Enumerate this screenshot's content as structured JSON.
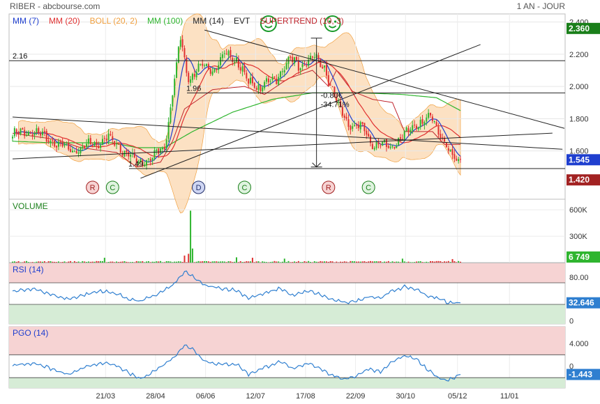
{
  "header": {
    "title": "RIBER - abcbourse.com",
    "period": "1 AN - JOUR"
  },
  "legend": [
    {
      "label": "MM (7)",
      "color": "#1f3fcf"
    },
    {
      "label": "MM (20)",
      "color": "#e03131"
    },
    {
      "label": "BOLL (20, 2)",
      "color": "#f0a040"
    },
    {
      "label": "MM (100)",
      "color": "#2fb52f"
    },
    {
      "label": "MM (14)",
      "color": "#222222"
    },
    {
      "label": "EVT",
      "color": "#222222"
    },
    {
      "label": "SUPERTREND (10, 3)",
      "color": "#c0262e"
    }
  ],
  "colors": {
    "up": "#2fb52f",
    "down": "#e03131",
    "ma7": "#1f3fcf",
    "ma20": "#e03131",
    "ma100": "#2fb52f",
    "boll_fill": "#fbdcb8",
    "boll_edge": "#f0a040",
    "rsi_line": "#2f7fd0",
    "overbought": "#f6d3d3",
    "oversold": "#d6ecd6",
    "tag_up": "#1a7f1a",
    "tag_mid": "#23306b",
    "tag_down": "#a22222"
  },
  "chart_data": [
    {
      "type": "candlestick",
      "panel": "price",
      "x_ticks": [
        "21/03",
        "28/04",
        "06/06",
        "12/07",
        "17/08",
        "22/09",
        "30/10",
        "05/12",
        "11/01"
      ],
      "ylim": [
        1.3,
        2.45
      ],
      "y_ticks": [
        1.6,
        1.8,
        2.0,
        2.2,
        2.4
      ],
      "y_tick_labels": [
        "1.600",
        "1.800",
        "2.000",
        "2.200",
        "2.400"
      ],
      "badges": [
        {
          "value": 2.36,
          "label": "2.360",
          "color": "#1a7f1a"
        },
        {
          "value": 1.545,
          "label": "1.545",
          "color": "#1f3fcf"
        },
        {
          "value": 1.42,
          "label": "1.420",
          "color": "#a22222"
        }
      ],
      "anchors": [
        [
          0,
          1.7
        ],
        [
          10,
          1.72
        ],
        [
          20,
          1.66
        ],
        [
          28,
          1.6
        ],
        [
          38,
          1.63
        ],
        [
          48,
          1.68
        ],
        [
          56,
          1.6
        ],
        [
          62,
          1.53
        ],
        [
          70,
          1.55
        ],
        [
          76,
          1.63
        ],
        [
          80,
          1.95
        ],
        [
          84,
          2.3
        ],
        [
          88,
          2.05
        ],
        [
          94,
          2.12
        ],
        [
          100,
          2.1
        ],
        [
          106,
          2.2
        ],
        [
          112,
          2.17
        ],
        [
          118,
          2.02
        ],
        [
          124,
          2.0
        ],
        [
          132,
          2.05
        ],
        [
          138,
          2.17
        ],
        [
          144,
          2.12
        ],
        [
          150,
          2.18
        ],
        [
          156,
          2.12
        ],
        [
          162,
          1.9
        ],
        [
          168,
          1.76
        ],
        [
          174,
          1.75
        ],
        [
          180,
          1.65
        ],
        [
          188,
          1.62
        ],
        [
          196,
          1.7
        ],
        [
          204,
          1.78
        ],
        [
          210,
          1.8
        ],
        [
          214,
          1.72
        ],
        [
          218,
          1.6
        ],
        [
          222,
          1.53
        ],
        [
          224,
          1.545
        ]
      ],
      "supertrend": [
        [
          0,
          1.71
        ],
        [
          22,
          1.67
        ],
        [
          34,
          1.62
        ],
        [
          52,
          1.59
        ],
        [
          62,
          1.5
        ],
        [
          74,
          1.53
        ],
        [
          80,
          1.66
        ],
        [
          86,
          1.86
        ],
        [
          100,
          1.98
        ],
        [
          116,
          2.0
        ],
        [
          126,
          1.95
        ],
        [
          138,
          2.05
        ],
        [
          150,
          2.1
        ],
        [
          158,
          2.0
        ],
        [
          162,
          2.1
        ],
        [
          170,
          1.97
        ],
        [
          180,
          1.92
        ],
        [
          190,
          1.9
        ],
        [
          196,
          1.72
        ],
        [
          210,
          1.72
        ],
        [
          216,
          1.64
        ],
        [
          224,
          1.64
        ]
      ],
      "ma100": [
        [
          0,
          1.66
        ],
        [
          20,
          1.65
        ],
        [
          50,
          1.65
        ],
        [
          62,
          1.62
        ],
        [
          76,
          1.62
        ],
        [
          90,
          1.72
        ],
        [
          110,
          1.84
        ],
        [
          130,
          1.92
        ],
        [
          150,
          1.96
        ],
        [
          175,
          1.96
        ],
        [
          195,
          1.95
        ],
        [
          212,
          1.93
        ],
        [
          224,
          1.85
        ]
      ],
      "horizontal_lines": [
        {
          "value": 2.16,
          "label": "2.16"
        },
        {
          "value": 1.96,
          "label": "1.96"
        },
        {
          "value": 1.49,
          "label": "1.49"
        }
      ],
      "trend_lines": [
        {
          "from": [
            0,
            1.81
          ],
          "to": [
            275,
            1.61
          ]
        },
        {
          "from": [
            0,
            1.55
          ],
          "to": [
            270,
            1.71
          ]
        },
        {
          "from": [
            96,
            2.35
          ],
          "to": [
            276,
            1.74
          ]
        },
        {
          "from": [
            64,
            1.43
          ],
          "to": [
            234,
            2.26
          ]
        }
      ],
      "measure": {
        "from": 2.3,
        "to": 1.5,
        "labels": [
          "-0.80€",
          "-34.71%"
        ]
      },
      "markers": [
        {
          "label": "R",
          "kind": "down"
        },
        {
          "label": "C",
          "kind": "up"
        },
        {
          "label": "D",
          "kind": "mid"
        },
        {
          "label": "C",
          "kind": "up"
        },
        {
          "label": "R",
          "kind": "down"
        },
        {
          "label": "C",
          "kind": "up"
        }
      ],
      "markers_x": [
        40,
        50,
        93,
        116,
        158,
        178
      ],
      "smileys_x": [
        128,
        160
      ]
    },
    {
      "type": "bar",
      "panel": "volume",
      "title": "VOLUME",
      "ylim": [
        0,
        720000
      ],
      "y_ticks": [
        300000,
        600000
      ],
      "y_tick_labels": [
        "300K",
        "600K"
      ],
      "badge": "6 749",
      "spikes": [
        [
          89,
          590000
        ],
        [
          88,
          100000
        ],
        [
          90,
          160000
        ],
        [
          86,
          80000
        ],
        [
          46,
          55000
        ],
        [
          112,
          60000
        ],
        [
          120,
          55000
        ],
        [
          136,
          45000
        ],
        [
          195,
          45000
        ],
        [
          220,
          40000
        ]
      ]
    },
    {
      "type": "line",
      "panel": "rsi",
      "title": "RSI (14)",
      "ylim": [
        -6,
        106
      ],
      "y_ticks": [
        0,
        80
      ],
      "y_tick_labels": [
        "0",
        "80.00"
      ],
      "bands": {
        "top": 70,
        "bottom": 30
      },
      "badge": "32.646",
      "anchors": [
        [
          0,
          55
        ],
        [
          12,
          58
        ],
        [
          22,
          45
        ],
        [
          28,
          40
        ],
        [
          34,
          46
        ],
        [
          44,
          55
        ],
        [
          52,
          50
        ],
        [
          58,
          40
        ],
        [
          64,
          36
        ],
        [
          72,
          48
        ],
        [
          80,
          65
        ],
        [
          86,
          90
        ],
        [
          90,
          82
        ],
        [
          96,
          65
        ],
        [
          104,
          60
        ],
        [
          112,
          56
        ],
        [
          118,
          42
        ],
        [
          126,
          50
        ],
        [
          134,
          60
        ],
        [
          140,
          46
        ],
        [
          148,
          55
        ],
        [
          154,
          48
        ],
        [
          160,
          38
        ],
        [
          166,
          34
        ],
        [
          172,
          36
        ],
        [
          178,
          45
        ],
        [
          184,
          42
        ],
        [
          190,
          55
        ],
        [
          196,
          62
        ],
        [
          202,
          58
        ],
        [
          208,
          45
        ],
        [
          214,
          40
        ],
        [
          218,
          33
        ],
        [
          224,
          33
        ]
      ]
    },
    {
      "type": "line",
      "panel": "pgo",
      "title": "PGO (14)",
      "ylim": [
        -3.8,
        6.9
      ],
      "y_ticks": [
        0,
        4
      ],
      "y_tick_labels": [
        "0",
        "4.000"
      ],
      "bands": {
        "top": 2.0,
        "bottom": -2.0
      },
      "badge": "-1.443",
      "anchors": [
        [
          0,
          0.2
        ],
        [
          12,
          0.5
        ],
        [
          22,
          -0.8
        ],
        [
          28,
          -1.5
        ],
        [
          34,
          -0.5
        ],
        [
          44,
          0.6
        ],
        [
          52,
          0.1
        ],
        [
          58,
          -1.2
        ],
        [
          64,
          -2.2
        ],
        [
          72,
          -0.6
        ],
        [
          80,
          1.4
        ],
        [
          86,
          3.6
        ],
        [
          90,
          3.1
        ],
        [
          96,
          0.9
        ],
        [
          104,
          0.3
        ],
        [
          112,
          0.4
        ],
        [
          118,
          -1.4
        ],
        [
          126,
          -0.2
        ],
        [
          134,
          0.8
        ],
        [
          140,
          -0.5
        ],
        [
          148,
          0.6
        ],
        [
          154,
          -0.4
        ],
        [
          160,
          -1.7
        ],
        [
          166,
          -2.2
        ],
        [
          172,
          -1.7
        ],
        [
          178,
          -0.4
        ],
        [
          184,
          -1.0
        ],
        [
          190,
          0.8
        ],
        [
          196,
          1.8
        ],
        [
          202,
          1.2
        ],
        [
          208,
          -0.8
        ],
        [
          214,
          -2.2
        ],
        [
          218,
          -2.4
        ],
        [
          224,
          -1.44
        ]
      ]
    }
  ]
}
